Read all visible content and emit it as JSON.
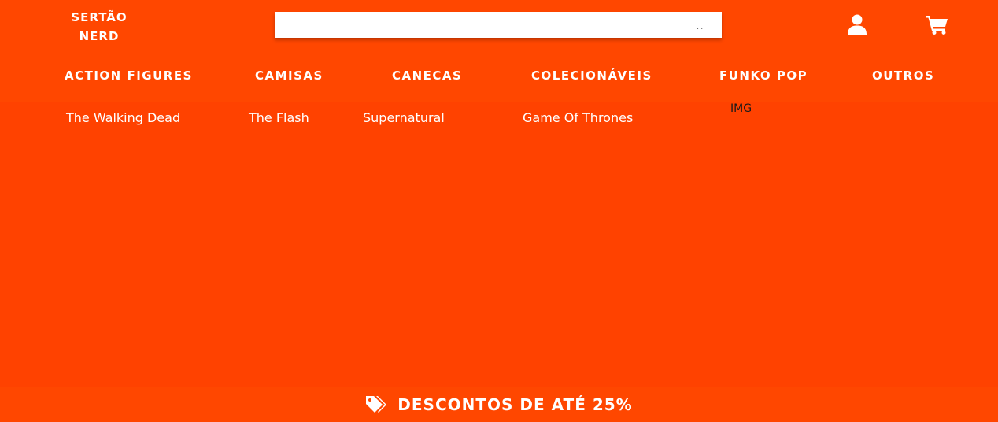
{
  "colors": {
    "brand": "#ff4200",
    "bar": "#ff4700",
    "text": "#ffffff"
  },
  "header": {
    "logo_line1": "SERTÃO",
    "logo_line2": "NERD",
    "search_placeholder": "",
    "search_hint": ". .",
    "icons": [
      "user-icon",
      "cart-icon"
    ]
  },
  "nav": {
    "items": [
      {
        "label": "ACTION FIGURES"
      },
      {
        "label": "CAMISAS"
      },
      {
        "label": "CANECAS"
      },
      {
        "label": "COLECIONÁVEIS"
      },
      {
        "label": "FUNKO POP"
      },
      {
        "label": "OUTROS"
      }
    ]
  },
  "submenu": {
    "items": [
      {
        "label": "The Walking Dead"
      },
      {
        "label": "The Flash"
      },
      {
        "label": "Supernatural"
      },
      {
        "label": "Game Of Thrones"
      }
    ],
    "image_alt": "IMG"
  },
  "promo": {
    "icon": "tags-icon",
    "text": "DESCONTOS DE ATÉ 25%"
  }
}
